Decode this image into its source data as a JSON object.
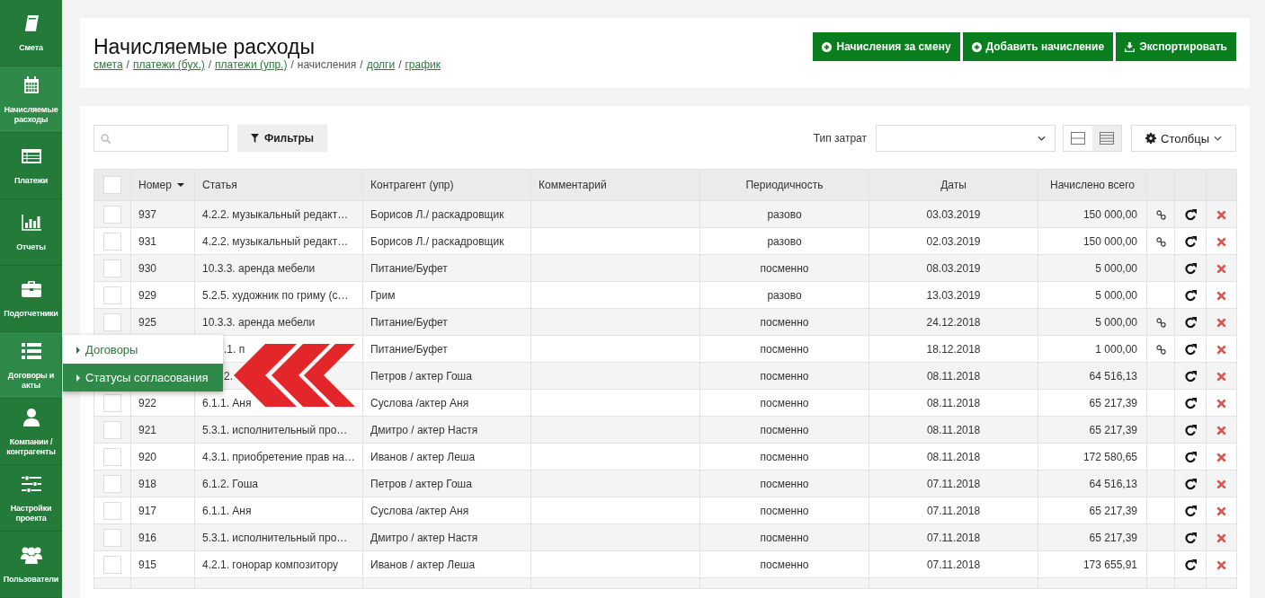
{
  "sidebar": {
    "items": [
      {
        "label": "Смета",
        "selected": false
      },
      {
        "label": "Начисляемые расходы",
        "selected": true
      },
      {
        "label": "Платежи",
        "selected": false
      },
      {
        "label": "Отчеты",
        "selected": false
      },
      {
        "label": "Подотчетники",
        "selected": false
      },
      {
        "label": "Договоры и акты",
        "selected": true
      },
      {
        "label": "Компании / контрагенты",
        "selected": false
      },
      {
        "label": "Настройки проекта",
        "selected": false
      },
      {
        "label": "Пользователи",
        "selected": false
      }
    ]
  },
  "flyout_menu": {
    "items": [
      {
        "label": "Договоры",
        "selected": false
      },
      {
        "label": "Статусы согласования",
        "selected": true
      }
    ]
  },
  "header": {
    "title": "Начисляемые расходы",
    "breadcrumb_separator": "/",
    "breadcrumbs": [
      {
        "label": "смета",
        "link": true
      },
      {
        "label": "платежи (бух.)",
        "link": true
      },
      {
        "label": "платежи (упр.)",
        "link": true
      },
      {
        "label": "начисления",
        "link": false
      },
      {
        "label": "долги",
        "link": true
      },
      {
        "label": "график",
        "link": true
      }
    ],
    "buttons": [
      {
        "label": "Начисления за смену",
        "kind": "add"
      },
      {
        "label": "Добавить начисление",
        "kind": "add"
      },
      {
        "label": "Экспортировать",
        "kind": "export"
      }
    ]
  },
  "toolbar": {
    "filters_button": "Фильтры",
    "cost_type_label": "Тип затрат",
    "views": [
      {
        "kind": "split",
        "selected": false
      },
      {
        "kind": "rows",
        "selected": true
      }
    ],
    "columns_button": "Столбцы"
  },
  "table": {
    "select_all": {
      "checked": false
    },
    "columns": [
      {
        "label": "Номер",
        "sorted": true
      },
      {
        "label": "Статья",
        "sorted": false
      },
      {
        "label": "Контрагент (упр)",
        "sorted": false
      },
      {
        "label": "Комментарий",
        "sorted": false
      },
      {
        "label": "Периодичность",
        "sorted": false
      },
      {
        "label": "Даты",
        "sorted": false
      },
      {
        "label": "Начислено всего",
        "sorted": false
      }
    ],
    "rows": [
      {
        "covered": false,
        "checked": false,
        "number": "937",
        "article": "4.2.2. музыкальный редакт…",
        "counterparty": "Борисов Л./ раскадровщик",
        "periodicity": "разово",
        "date": "03.03.2019",
        "total": "150 000,00",
        "linked": true
      },
      {
        "covered": false,
        "checked": false,
        "number": "931",
        "article": "4.2.2. музыкальный редакт…",
        "counterparty": "Борисов Л./ раскадровщик",
        "periodicity": "разово",
        "date": "02.03.2019",
        "total": "150 000,00",
        "linked": true
      },
      {
        "covered": false,
        "checked": false,
        "number": "930",
        "article": "10.3.3. аренда мебели",
        "counterparty": "Питание/Буфет",
        "periodicity": "посменно",
        "date": "08.03.2019",
        "total": "5 000,00",
        "linked": false
      },
      {
        "covered": false,
        "checked": false,
        "number": "929",
        "article": "5.2.5. художник по гриму (с…",
        "counterparty": "Грим",
        "periodicity": "разово",
        "date": "13.03.2019",
        "total": "5 000,00",
        "linked": false
      },
      {
        "covered": false,
        "checked": false,
        "number": "925",
        "article": "10.3.3. аренда мебели",
        "counterparty": "Питание/Буфет",
        "periodicity": "посменно",
        "date": "24.12.2018",
        "total": "5 000,00",
        "linked": true
      },
      {
        "covered": true,
        "article": ".1. п",
        "counterparty": "Питание/Буфет",
        "periodicity": "посменно",
        "date": "18.12.2018",
        "total": "1 000,00",
        "linked": true
      },
      {
        "covered": true,
        "article": "2.",
        "counterparty": "Петров / актер Гоша",
        "periodicity": "посменно",
        "date": "08.11.2018",
        "total": "64 516,13",
        "linked": false
      },
      {
        "covered": false,
        "checked": false,
        "number": "922",
        "article": "6.1.1. Аня",
        "counterparty": "Суслова /актер Аня",
        "periodicity": "посменно",
        "date": "08.11.2018",
        "total": "65 217,39",
        "linked": false
      },
      {
        "covered": false,
        "checked": false,
        "number": "921",
        "article": "5.3.1. исполнительный про…",
        "counterparty": "Дмитро / актер Настя",
        "periodicity": "посменно",
        "date": "08.11.2018",
        "total": "65 217,39",
        "linked": false
      },
      {
        "covered": false,
        "checked": false,
        "number": "920",
        "article": "4.3.1. приобретение прав на…",
        "counterparty": "Иванов / актер Леша",
        "periodicity": "посменно",
        "date": "08.11.2018",
        "total": "172 580,65",
        "linked": false
      },
      {
        "covered": false,
        "checked": false,
        "number": "918",
        "article": "6.1.2. Гоша",
        "counterparty": "Петров / актер Гоша",
        "periodicity": "посменно",
        "date": "07.11.2018",
        "total": "64 516,13",
        "linked": false
      },
      {
        "covered": false,
        "checked": false,
        "number": "917",
        "article": "6.1.1. Аня",
        "counterparty": "Суслова /актер Аня",
        "periodicity": "посменно",
        "date": "07.11.2018",
        "total": "65 217,39",
        "linked": false
      },
      {
        "covered": false,
        "checked": false,
        "number": "916",
        "article": "5.3.1. исполнительный про…",
        "counterparty": "Дмитро / актер Настя",
        "periodicity": "посменно",
        "date": "07.11.2018",
        "total": "65 217,39",
        "linked": false
      },
      {
        "covered": false,
        "checked": false,
        "number": "915",
        "article": "4.2.1. гонорар композитору",
        "counterparty": "Иванов / актер Леша",
        "periodicity": "посменно",
        "date": "07.11.2018",
        "total": "173 655,91",
        "linked": false
      }
    ]
  }
}
